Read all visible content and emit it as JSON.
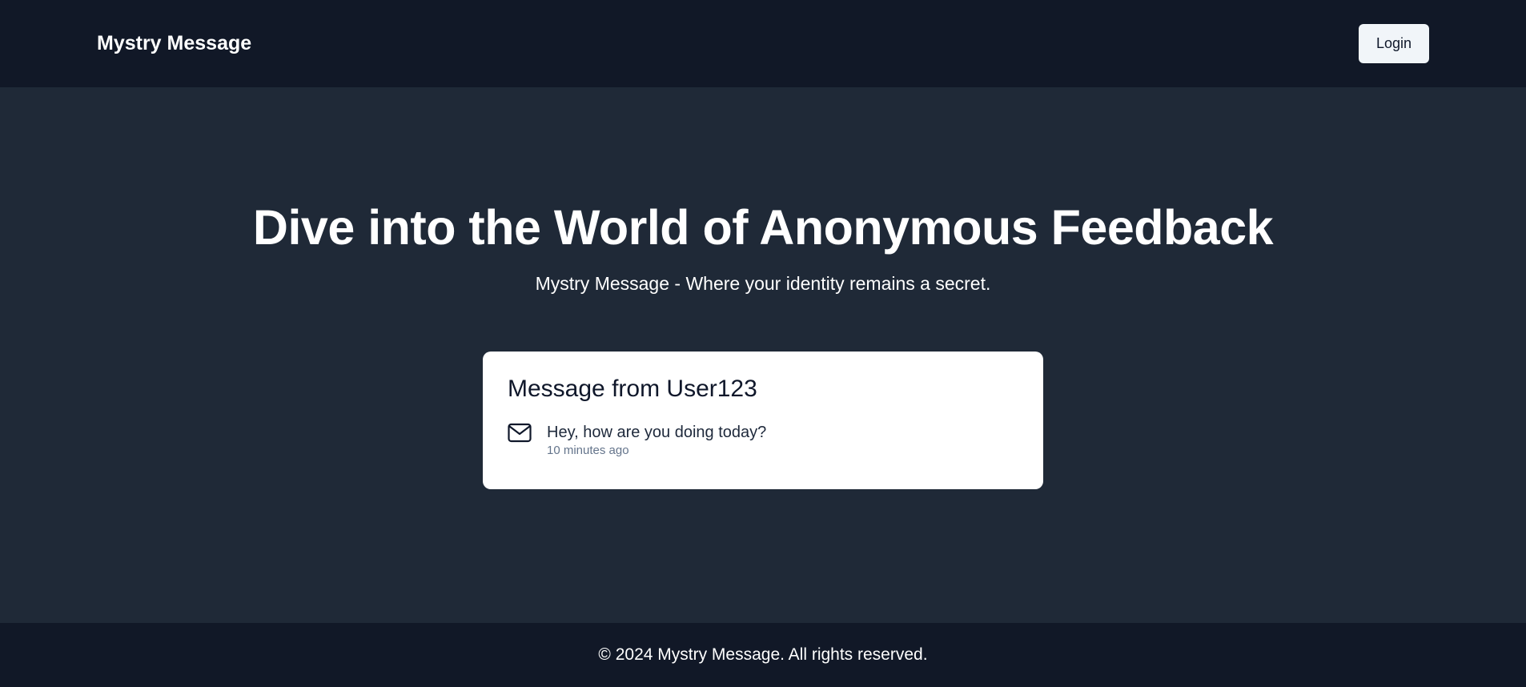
{
  "navbar": {
    "brand": "Mystry Message",
    "login_label": "Login"
  },
  "hero": {
    "title": "Dive into the World of Anonymous Feedback",
    "subtitle": "Mystry Message - Where your identity remains a secret."
  },
  "card": {
    "title": "Message from User123",
    "icon": "mail-icon",
    "message": "Hey, how are you doing today?",
    "time": "10 minutes ago"
  },
  "footer": {
    "text": "© 2024 Mystry Message. All rights reserved."
  },
  "colors": {
    "navbar_bg": "#111827",
    "main_bg": "#1f2937",
    "card_bg": "#ffffff",
    "button_bg": "#f1f5f9"
  }
}
